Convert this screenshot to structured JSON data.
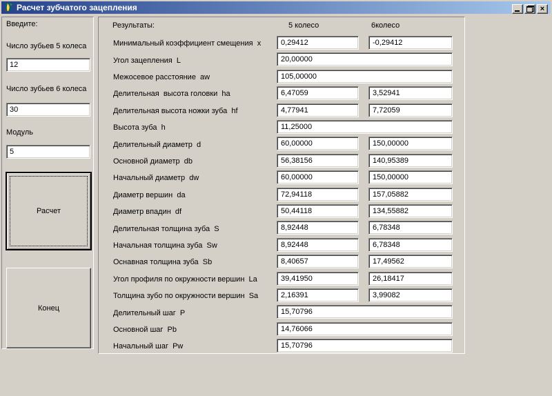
{
  "window": {
    "title": "Расчет зубчатого зацепления",
    "controls": {
      "close_glyph": "×"
    }
  },
  "colors": {
    "titlebar_left": "#26428c",
    "titlebar_right": "#a8c8ec",
    "form_bg": "#d4d0c8"
  },
  "input_panel": {
    "title": "Введите:",
    "fields": [
      {
        "label": "Число зубьев 5 колеса",
        "value": "12"
      },
      {
        "label": "Число зубьев 6 колеса",
        "value": "30"
      },
      {
        "label": "Модуль",
        "value": "5"
      }
    ],
    "buttons": {
      "calc": "Расчет",
      "end": "Конец"
    }
  },
  "results_panel": {
    "title": "Результаты:",
    "col_headers": [
      "5 колесо",
      "6колесо"
    ],
    "rows": [
      {
        "label": "Минимальный коэффициент смещения  x",
        "type": "two",
        "values": [
          "0,29412",
          "-0,29412"
        ]
      },
      {
        "label": "Угол зацепления  L",
        "type": "wide",
        "values": [
          "20,00000"
        ]
      },
      {
        "label": "Межосевое расстояние  aw",
        "type": "wide",
        "values": [
          "105,00000"
        ]
      },
      {
        "label": "Делительная  высота головки  ha",
        "type": "two",
        "values": [
          "6,47059",
          "3,52941"
        ]
      },
      {
        "label": "Делительная высота ножки зуба  hf",
        "type": "two",
        "values": [
          "4,77941",
          "7,72059"
        ]
      },
      {
        "label": "Высота зуба  h",
        "type": "wide",
        "values": [
          "11,25000"
        ]
      },
      {
        "label": "Делительный диаметр  d",
        "type": "two",
        "values": [
          "60,00000",
          "150,00000"
        ]
      },
      {
        "label": "Основной диаметр  db",
        "type": "two",
        "values": [
          "56,38156",
          "140,95389"
        ]
      },
      {
        "label": "Начальный диаметр  dw",
        "type": "two",
        "values": [
          "60,00000",
          "150,00000"
        ]
      },
      {
        "label": "Диаметр вершин  da",
        "type": "two",
        "values": [
          "72,94118",
          "157,05882"
        ]
      },
      {
        "label": "Диаметр впадин  df",
        "type": "two",
        "values": [
          "50,44118",
          "134,55882"
        ]
      },
      {
        "label": "Делительная толщина зуба  S",
        "type": "two",
        "values": [
          "8,92448",
          "6,78348"
        ]
      },
      {
        "label": "Начальная толщина зуба  Sw",
        "type": "two",
        "values": [
          "8,92448",
          "6,78348"
        ]
      },
      {
        "label": "Оснавная толщина зуба  Sb",
        "type": "two",
        "values": [
          "8,40657",
          "17,49562"
        ]
      },
      {
        "label": "Угол профиля по окружности вершин  La",
        "type": "two",
        "values": [
          "39,41950",
          "26,18417"
        ]
      },
      {
        "label": "Толщина зубо по окружности вершин  Sa",
        "type": "two",
        "values": [
          "2,16391",
          "3,99082"
        ]
      },
      {
        "label": "Делительный шаг  P",
        "type": "wide",
        "values": [
          "15,70796"
        ]
      },
      {
        "label": "Основной шаг  Pb",
        "type": "wide",
        "values": [
          "14,76066"
        ]
      },
      {
        "label": "Начальный шаг  Pw",
        "type": "wide",
        "values": [
          "15,70796"
        ]
      }
    ]
  }
}
